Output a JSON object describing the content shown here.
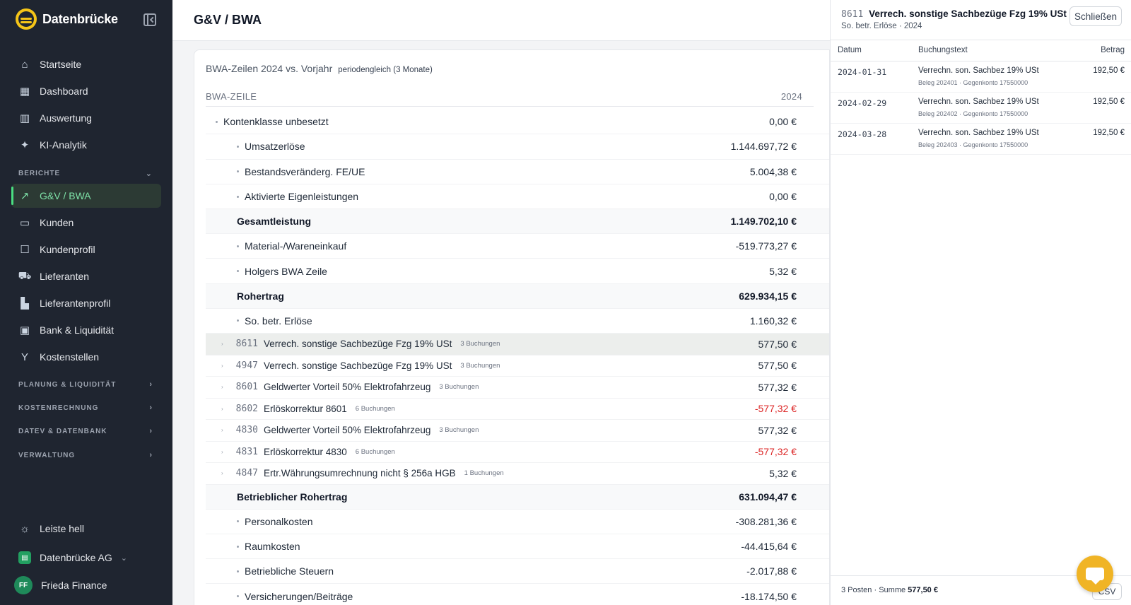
{
  "brand": {
    "name": "Datenbrücke"
  },
  "nav": {
    "main": [
      {
        "label": "Startseite",
        "icon": "home-icon",
        "glyph": "⌂"
      },
      {
        "label": "Dashboard",
        "icon": "dashboard-icon",
        "glyph": "▦"
      },
      {
        "label": "Auswertung",
        "icon": "bar-chart-icon",
        "glyph": "▥"
      },
      {
        "label": "KI-Analytik",
        "icon": "sparkle-icon",
        "glyph": "✦"
      }
    ],
    "sections": {
      "berichte": "BERICHTE",
      "planung": "PLANUNG & LIQUIDITÄT",
      "kosten": "KOSTENRECHNUNG",
      "datev": "DATEV & DATENBANK",
      "verwaltung": "VERWALTUNG"
    },
    "berichte": [
      {
        "label": "G&V / BWA",
        "icon": "trend-icon",
        "glyph": "↗"
      },
      {
        "label": "Kunden",
        "icon": "wallet-icon",
        "glyph": "▭"
      },
      {
        "label": "Kundenprofil",
        "icon": "profile-icon",
        "glyph": "☐"
      },
      {
        "label": "Lieferanten",
        "icon": "truck-icon",
        "glyph": "⛟"
      },
      {
        "label": "Lieferantenprofil",
        "icon": "factory-icon",
        "glyph": "▙"
      },
      {
        "label": "Bank & Liquidität",
        "icon": "bank-icon",
        "glyph": "▣"
      },
      {
        "label": "Kostenstellen",
        "icon": "fork-icon",
        "glyph": "Y"
      }
    ],
    "bottom": {
      "theme": "Leiste hell",
      "org": "Datenbrücke AG",
      "user": "Frieda Finance",
      "user_initials": "FF"
    }
  },
  "header": {
    "title": "G&V / BWA"
  },
  "report": {
    "title": "BWA-Zeilen 2024 vs. Vorjahr",
    "subtitle": "periodengleich (3 Monate)",
    "col_label": "BWA-ZEILE",
    "col_year": "2024",
    "rows": [
      {
        "type": "group",
        "label": "Kontenklasse unbesetzt",
        "value": "0,00 €"
      },
      {
        "type": "line",
        "label": "Umsatzerlöse",
        "value": "1.144.697,72 €"
      },
      {
        "type": "line",
        "label": "Bestandsveränderg. FE/UE",
        "value": "5.004,38 €"
      },
      {
        "type": "line",
        "label": "Aktivierte Eigenleistungen",
        "value": "0,00 €"
      },
      {
        "type": "sum",
        "label": "Gesamtleistung",
        "value": "1.149.702,10 €"
      },
      {
        "type": "line",
        "label": "Material-/Wareneinkauf",
        "value": "-519.773,27 €"
      },
      {
        "type": "line",
        "label": "Holgers BWA Zeile",
        "value": "5,32 €"
      },
      {
        "type": "sum",
        "label": "Rohertrag",
        "value": "629.934,15 €"
      },
      {
        "type": "line",
        "label": "So. betr. Erlöse",
        "value": "1.160,32 €"
      },
      {
        "type": "acct",
        "no": "8611",
        "label": "Verrech. sonstige Sachbezüge Fzg 19% USt",
        "count": "3 Buchungen",
        "value": "577,50 €",
        "neg": false,
        "highlight": true
      },
      {
        "type": "acct",
        "no": "4947",
        "label": "Verrech. sonstige Sachbezüge Fzg 19% USt",
        "count": "3 Buchungen",
        "value": "577,50 €",
        "neg": false
      },
      {
        "type": "acct",
        "no": "8601",
        "label": "Geldwerter Vorteil 50% Elektrofahrzeug",
        "count": "3 Buchungen",
        "value": "577,32 €",
        "neg": false
      },
      {
        "type": "acct",
        "no": "8602",
        "label": "Erlöskorrektur 8601",
        "count": "6 Buchungen",
        "value": "-577,32 €",
        "neg": true
      },
      {
        "type": "acct",
        "no": "4830",
        "label": "Geldwerter Vorteil 50% Elektrofahrzeug",
        "count": "3 Buchungen",
        "value": "577,32 €",
        "neg": false
      },
      {
        "type": "acct",
        "no": "4831",
        "label": "Erlöskorrektur 4830",
        "count": "6 Buchungen",
        "value": "-577,32 €",
        "neg": true
      },
      {
        "type": "acct",
        "no": "4847",
        "label": "Ertr.Währungsumrechnung nicht § 256a HGB",
        "count": "1 Buchungen",
        "value": "5,32 €",
        "neg": false
      },
      {
        "type": "sum",
        "label": "Betrieblicher Rohertrag",
        "value": "631.094,47 €"
      },
      {
        "type": "line",
        "label": "Personalkosten",
        "value": "-308.281,36 €"
      },
      {
        "type": "line",
        "label": "Raumkosten",
        "value": "-44.415,64 €"
      },
      {
        "type": "line",
        "label": "Betriebliche Steuern",
        "value": "-2.017,88 €"
      },
      {
        "type": "line",
        "label": "Versicherungen/Beiträge",
        "value": "-18.174,50 €"
      }
    ]
  },
  "panel": {
    "acct_no": "8611",
    "title": "Verrech. sonstige Sachbezüge Fzg 19% USt",
    "subtitle": "So. betr. Erlöse · 2024",
    "close_label": "Schließen",
    "cols": {
      "date": "Datum",
      "text": "Buchungstext",
      "amount": "Betrag"
    },
    "entries": [
      {
        "date": "2024-01-31",
        "text": "Verrechn. son. Sachbez 19% USt",
        "meta": "Beleg 202401 · Gegenkonto 17550000",
        "amount": "192,50 €"
      },
      {
        "date": "2024-02-29",
        "text": "Verrechn. son. Sachbez 19% USt",
        "meta": "Beleg 202402 · Gegenkonto 17550000",
        "amount": "192,50 €"
      },
      {
        "date": "2024-03-28",
        "text": "Verrechn. son. Sachbez 19% USt",
        "meta": "Beleg 202403 · Gegenkonto 17550000",
        "amount": "192,50 €"
      }
    ],
    "footer_prefix": "3 Posten · Summe",
    "footer_sum": "577,50 €",
    "csv_label": "CSV"
  },
  "colors": {
    "sidebar": "#1f2530",
    "accent": "#4ade80",
    "brand_yellow": "#f5c518",
    "negative": "#dc2626"
  }
}
